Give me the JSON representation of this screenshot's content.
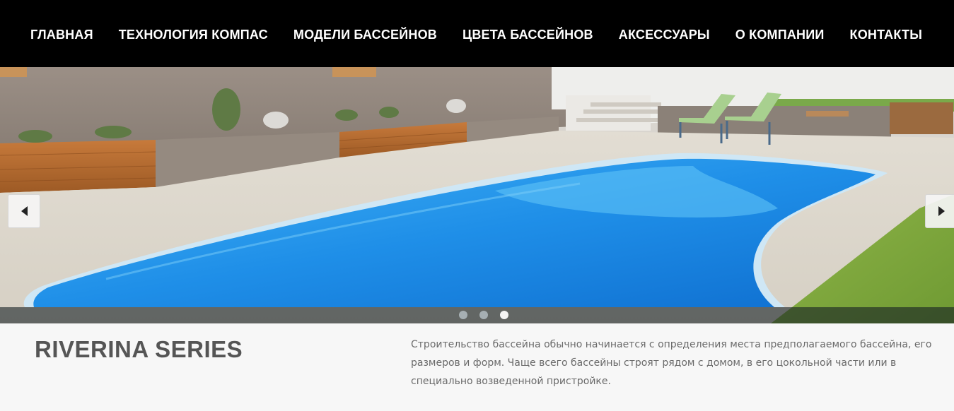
{
  "nav": {
    "items": [
      {
        "label": "ГЛАВНАЯ"
      },
      {
        "label": "ТЕХНОЛОГИЯ КОМПАС"
      },
      {
        "label": "МОДЕЛИ БАССЕЙНОВ"
      },
      {
        "label": "ЦВЕТА БАССЕЙНОВ"
      },
      {
        "label": "АКСЕССУАРЫ"
      },
      {
        "label": "О КОМПАНИИ"
      },
      {
        "label": "КОНТАКТЫ"
      }
    ]
  },
  "slider": {
    "prev_icon": "triangle-left-icon",
    "next_icon": "triangle-right-icon",
    "slide_count": 3,
    "active_slide": 3
  },
  "content": {
    "title": "RIVERINA SERIES",
    "description": "Строительство бассейна обычно начинается с определения места предполагаемого бассейна, его размеров и форм. Чаще всего бассейны строят рядом с домом, в его цокольной части или в специально возведенной пристройке."
  },
  "colors": {
    "nav_bg": "#000000",
    "nav_text": "#ffffff",
    "pool_water": "#1f8fe8",
    "title_text": "#555555",
    "body_text": "#6a6a6a"
  }
}
